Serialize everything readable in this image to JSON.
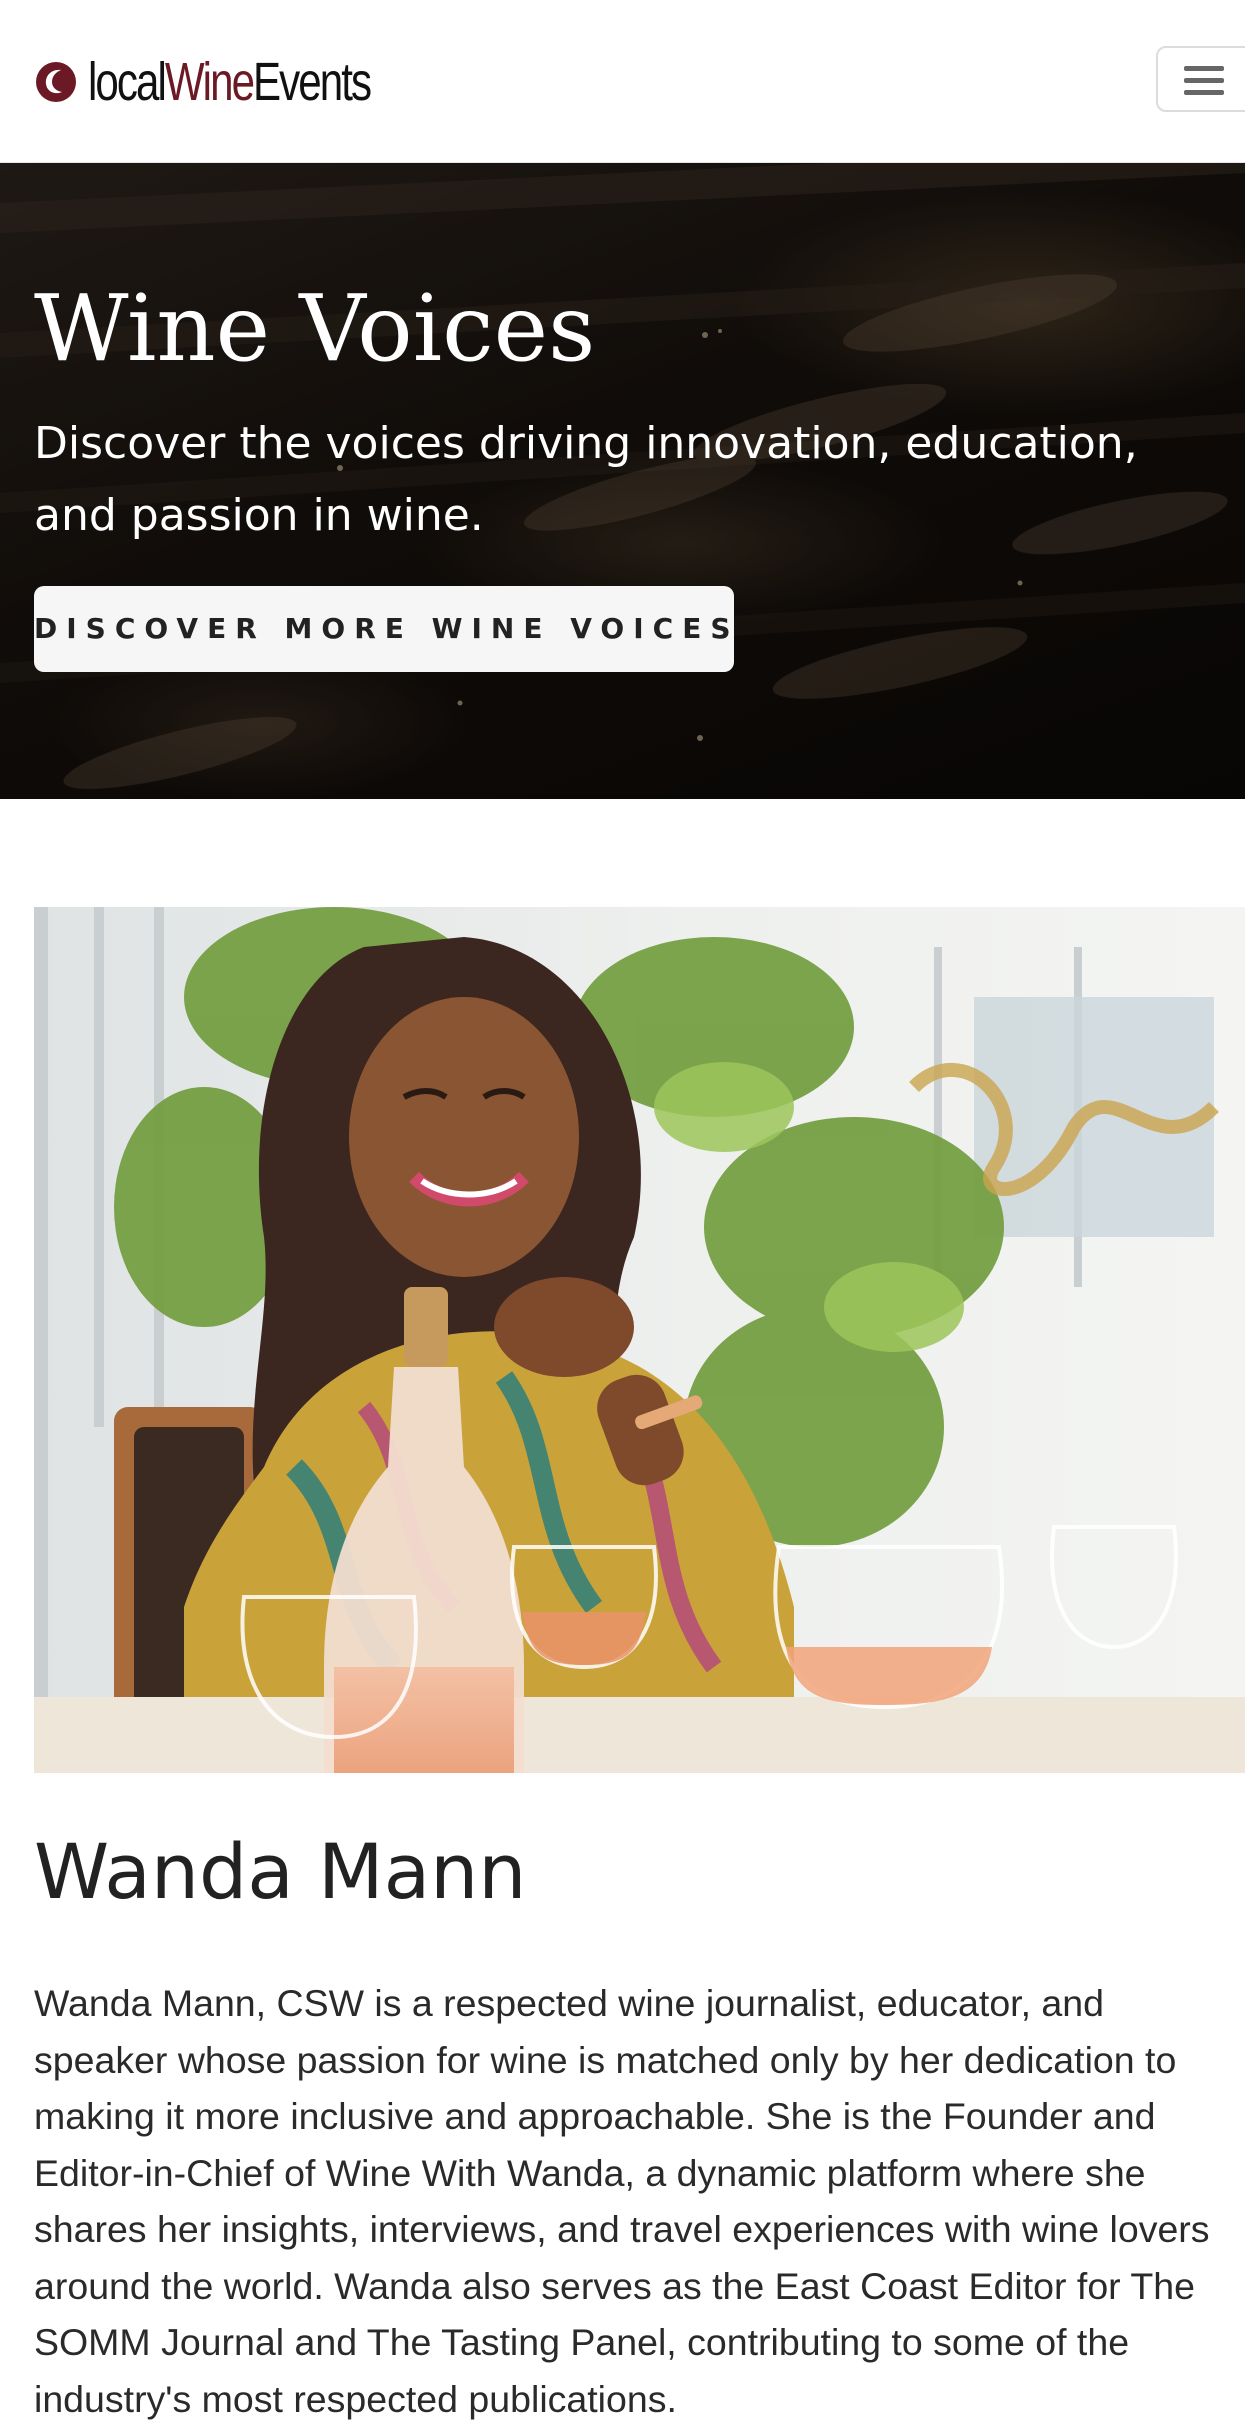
{
  "header": {
    "logo": {
      "part1": "local",
      "part2": "Wine",
      "part3": "Events"
    },
    "menu_icon": "hamburger-menu-icon"
  },
  "hero": {
    "title": "Wine Voices",
    "subtitle": "Discover the voices driving innovation, education, and passion in wine.",
    "button_label": "DISCOVER MORE WINE VOICES"
  },
  "profile": {
    "name": "Wanda Mann",
    "bio": "Wanda Mann, CSW is a respected wine journalist, educator, and speaker whose passion for wine is matched only by her dedication to making it more inclusive and approachable. She is the Founder and Editor-in-Chief of Wine With Wanda, a dynamic platform where she shares her insights, interviews, and travel experiences with wine lovers around the world. Wanda also serves as the East Coast Editor for The SOMM Journal and The Tasting Panel, contributing to some of the industry's most respected publications."
  },
  "colors": {
    "brand_wine": "#6b1a25",
    "hero_dark": "#15100c",
    "button_bg": "#f6f6f6",
    "text": "#222222"
  }
}
